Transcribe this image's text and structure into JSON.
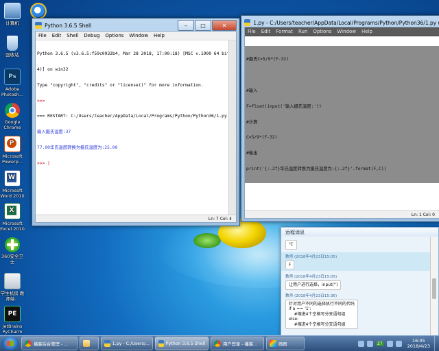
{
  "desktop": {
    "icons": [
      {
        "label": "计算机",
        "icon": "computer-icon"
      },
      {
        "label": "回收站",
        "icon": "recycle-bin-icon"
      },
      {
        "label": "Adobe Photosh...",
        "icon": "photoshop-icon"
      },
      {
        "label": "Google Chrome",
        "icon": "chrome-icon"
      },
      {
        "label": "Microsoft Powerp...",
        "icon": "powerpoint-icon"
      },
      {
        "label": "Microsoft Word 2010",
        "icon": "word-icon"
      },
      {
        "label": "Microsoft Excel 2010",
        "icon": "excel-icon"
      },
      {
        "label": "360安全卫士",
        "icon": "security-guard-icon"
      },
      {
        "label": "学生机房 教师端...",
        "icon": "classroom-icon"
      },
      {
        "label": "JetBrains PyCharm ...",
        "icon": "pycharm-icon"
      }
    ],
    "ie_icon": "internet-explorer-icon"
  },
  "shell": {
    "title": "Python 3.6.5 Shell",
    "menu": [
      "File",
      "Edit",
      "Shell",
      "Debug",
      "Options",
      "Window",
      "Help"
    ],
    "lines": [
      {
        "text": "Python 3.6.5 (v3.6.5:f59c0932b4, Mar 28 2018, 17:00:18) [MSC v.1900 64 bit (AMD6",
        "color": "#000000"
      },
      {
        "text": "4)] on win32",
        "color": "#000000"
      },
      {
        "text": "Type \"copyright\", \"credits\" or \"license()\" for more information.",
        "color": "#000000"
      },
      {
        "text": ">>> ",
        "color": "#c00000"
      },
      {
        "text": "=== RESTART: C:/Users/teacher/AppData/Local/Programs/Python/Python36/1.py ===",
        "color": "#000000"
      },
      {
        "text": "输入摄氏温度:37",
        "color": "#2a38d8"
      },
      {
        "text": "77.00华氏温度转换为摄氏温度为:25.00",
        "color": "#2a38d8"
      },
      {
        "text": ">>> |",
        "color": "#c00000"
      }
    ],
    "status": "Ln: 7   Col: 4"
  },
  "editor": {
    "title": "1.py - C:/Users/teacher/AppData/Local/Programs/Python/Python36/1.py (3.6.5)",
    "menu": [
      "File",
      "Edit",
      "Format",
      "Run",
      "Options",
      "Window",
      "Help"
    ],
    "lines": [
      "#摄氏C=5/9*(F-32)",
      "",
      "#输入",
      "F=float(input('输入摄氏温度:'))",
      "#计算",
      "C=5/9*(F-32)",
      "#输出",
      "print('{:.2f}华氏温度转换为摄氏温度为:{:.2f}'.format(F,C))"
    ],
    "status": "Ln: 1   Col: 0"
  },
  "chat": {
    "title": "远程消息",
    "messages": [
      {
        "meta": "",
        "text": "℃",
        "highlight": false
      },
      {
        "meta": "教师 (2018年4月23日15:05)",
        "text": "F",
        "highlight": true
      },
      {
        "meta": "教师 (2018年4月23日15:05)",
        "text": "让用户进行选择，input('')",
        "highlight": false
      },
      {
        "meta": "教师 (2018年4月23日15:36)",
        "text": "针对用户不同的选择执行不同的代码\nif a == '1':\n    #缩进4个空格写分支语句组\nelse:\n    #缩进4个空格写分支语句组",
        "highlight": false
      }
    ]
  },
  "taskbar": {
    "items": [
      {
        "label": "播客后台管理 - ...",
        "icon": "chrome-icon",
        "active": false
      },
      {
        "label": "",
        "icon": "folder-icon",
        "active": false
      },
      {
        "label": "1.py - C:/Users/...",
        "icon": "python-icon",
        "active": false
      },
      {
        "label": "Python 3.6.5 Shell",
        "icon": "python-icon",
        "active": true
      },
      {
        "label": "用户登录 - 播客...",
        "icon": "chrome-icon",
        "active": false
      },
      {
        "label": "画图",
        "icon": "paint-icon",
        "active": false
      }
    ],
    "tray_badge": "27",
    "time": "16:05",
    "date": "2018/4/23"
  }
}
